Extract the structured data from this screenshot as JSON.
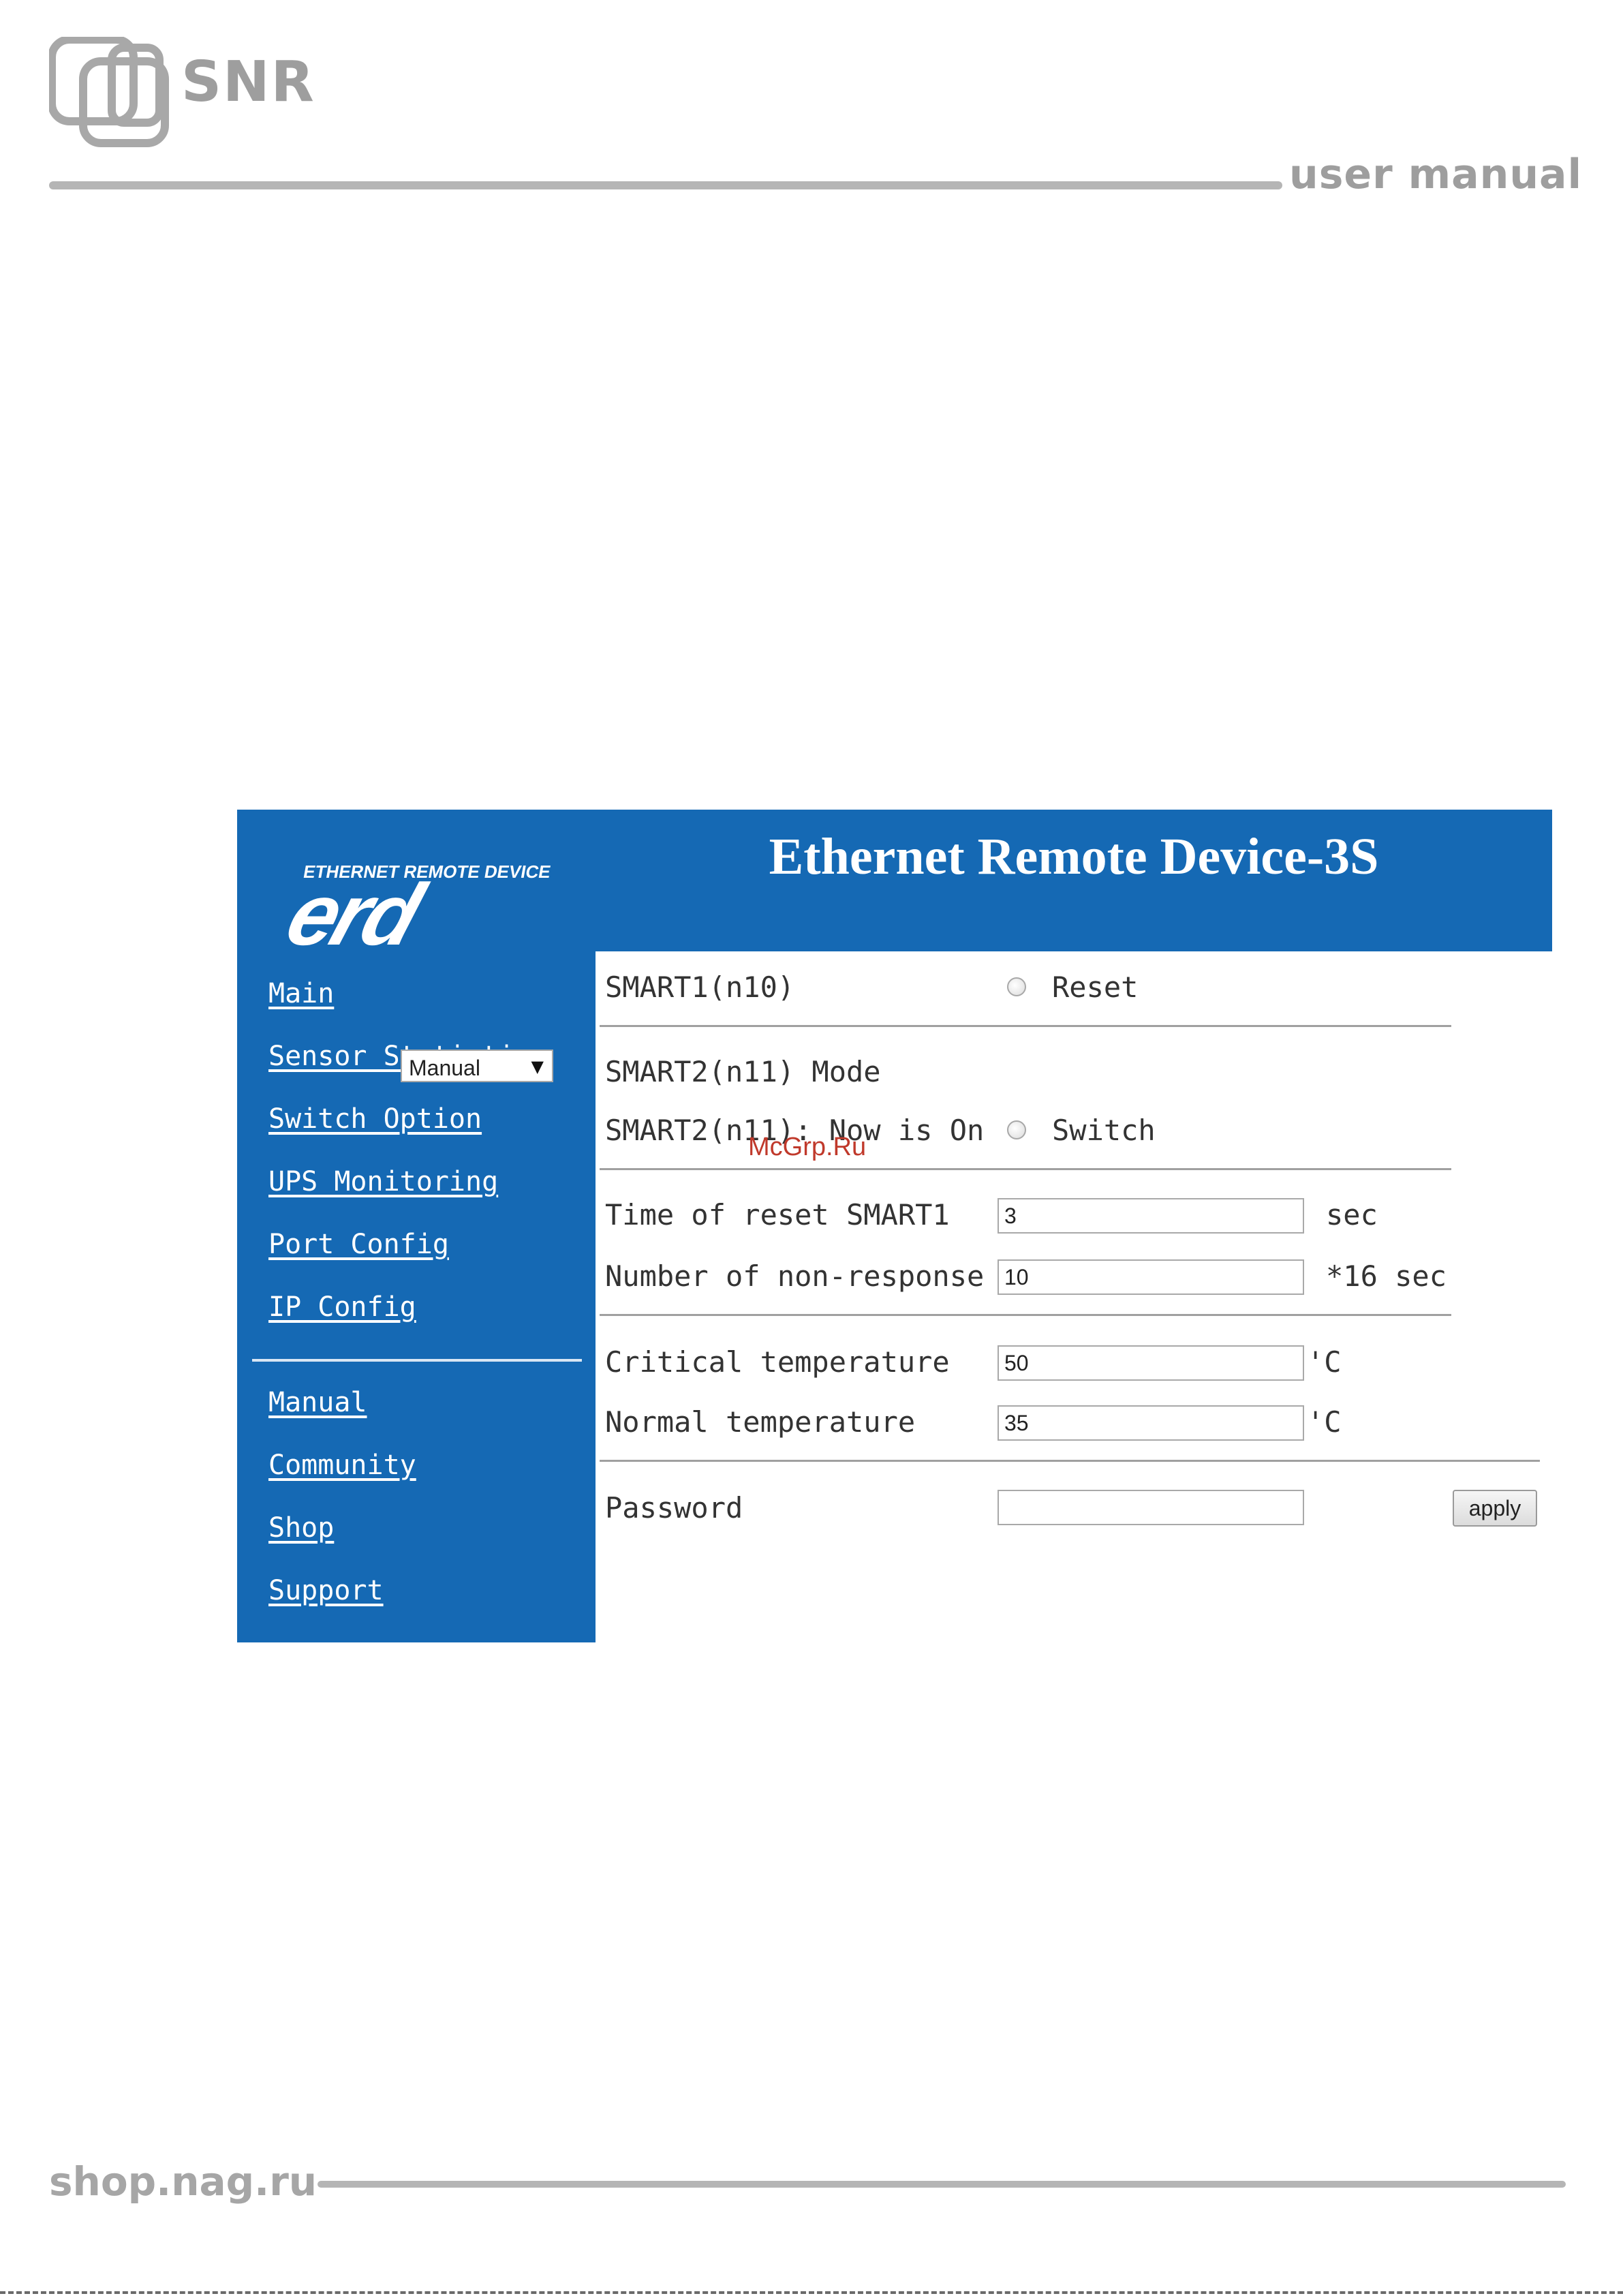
{
  "page": {
    "brand": "SNR",
    "doc_type": "user manual",
    "footer_site": "shop.nag.ru",
    "watermark": "McGrp.Ru"
  },
  "app": {
    "title": "Ethernet Remote Device-3S",
    "logo_caption": "ETHERNET REMOTE DEVICE",
    "logo_word": "erd",
    "accent_color": "#1569b4"
  },
  "nav": {
    "items": [
      "Main",
      "Sensor Statistic",
      "Switch Option",
      "UPS Monitoring",
      "Port Config",
      "IP Config"
    ],
    "links": [
      "Manual",
      "Community",
      "Shop",
      "Support"
    ]
  },
  "form": {
    "smart1": {
      "label": "SMART1(n10)",
      "action": "Reset"
    },
    "smart2_mode": {
      "label": "SMART2(n11) Mode",
      "selected": "Manual"
    },
    "smart2_state": {
      "label": "SMART2(n11): Now is On",
      "action": "Switch"
    },
    "reset_time": {
      "label": "Time of reset SMART1",
      "value": "3",
      "unit": "sec"
    },
    "non_response": {
      "label": "Number of non-response",
      "value": "10",
      "unit": "*16 sec"
    },
    "critical_temp": {
      "label": "Critical temperature",
      "value": "50",
      "unit": "'C"
    },
    "normal_temp": {
      "label": "Normal temperature",
      "value": "35",
      "unit": "'C"
    },
    "password": {
      "label": "Password",
      "value": ""
    },
    "apply_label": "apply"
  }
}
